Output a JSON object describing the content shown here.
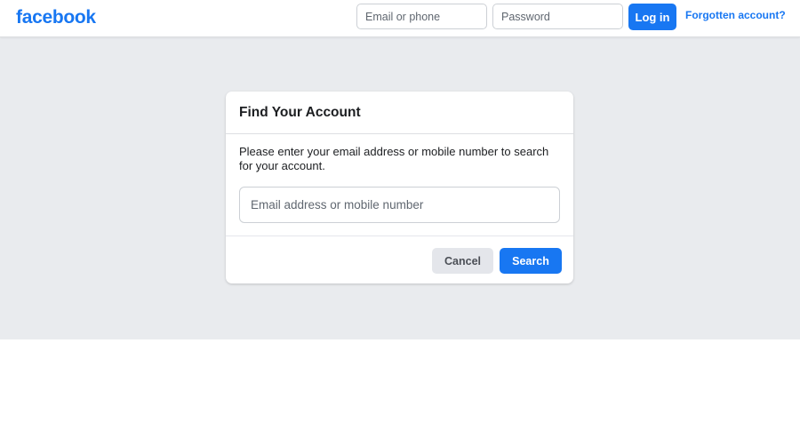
{
  "header": {
    "logo_text": "facebook",
    "email_placeholder": "Email or phone",
    "password_placeholder": "Password",
    "login_label": "Log in",
    "forgot_label": "Forgotten account?"
  },
  "find_account": {
    "title": "Find Your Account",
    "instructions": "Please enter your email address or mobile number to search for your account.",
    "input_placeholder": "Email address or mobile number",
    "input_value": "",
    "cancel_label": "Cancel",
    "search_label": "Search"
  },
  "colors": {
    "brand_blue": "#1877f2",
    "background_gray": "#e9ebee",
    "secondary_button": "#e4e6eb",
    "text_primary": "#1c1e21"
  }
}
